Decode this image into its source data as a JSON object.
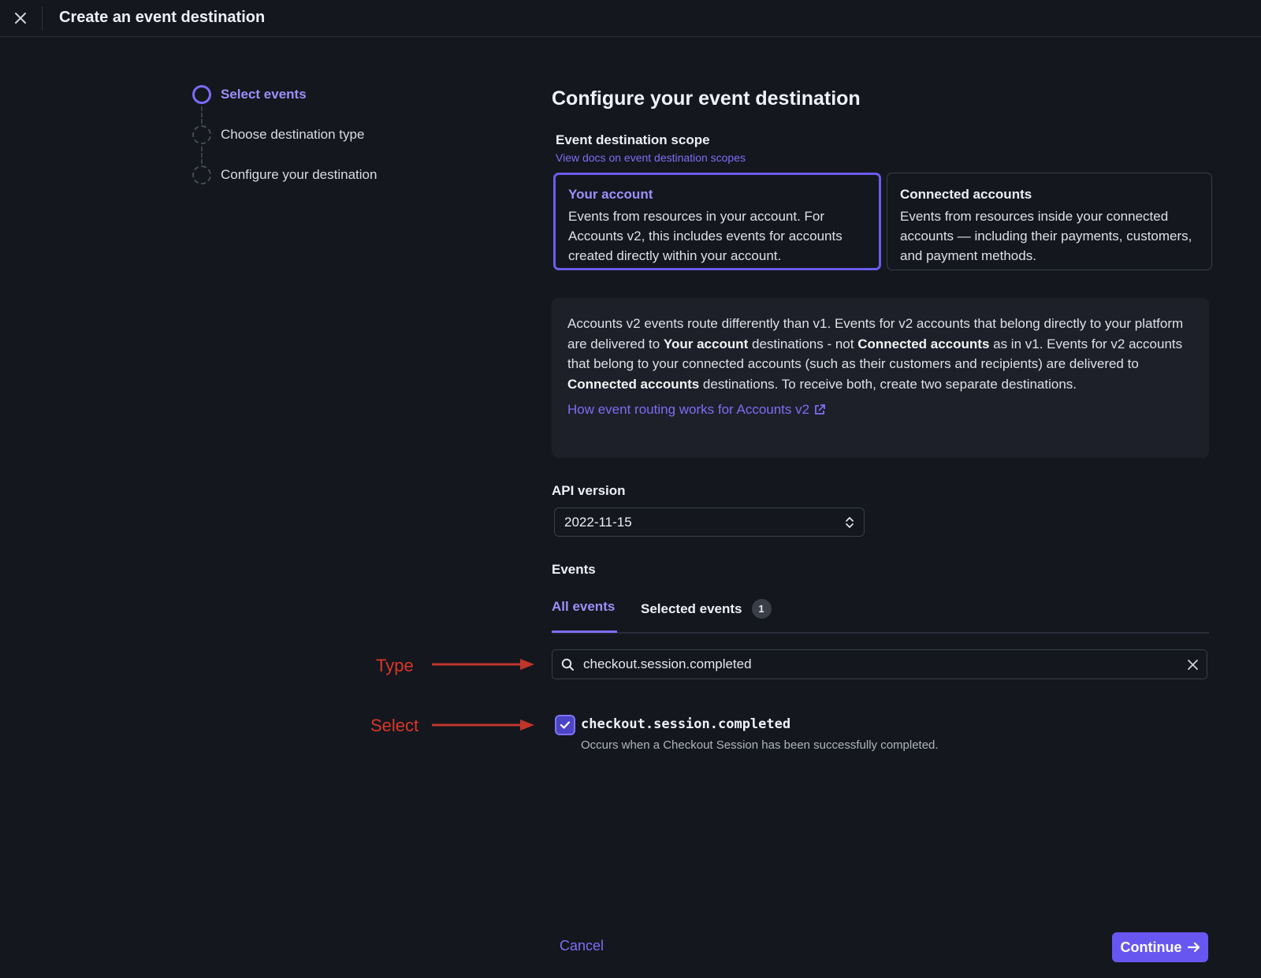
{
  "header": {
    "title": "Create an event destination"
  },
  "stepper": {
    "steps": [
      {
        "label": "Select events",
        "state": "active"
      },
      {
        "label": "Choose destination type",
        "state": "pending"
      },
      {
        "label": "Configure your destination",
        "state": "pending"
      }
    ]
  },
  "main": {
    "title": "Configure your event destination",
    "scope": {
      "title": "Event destination scope",
      "docs_link": "View docs on event destination scopes",
      "options": [
        {
          "title": "Your account",
          "description": "Events from resources in your account. For Accounts v2, this includes events for accounts created directly within your account.",
          "selected": true
        },
        {
          "title": "Connected accounts",
          "description": "Events from resources inside your connected accounts — including their payments, customers, and payment methods.",
          "selected": false
        }
      ]
    },
    "info": {
      "p1": "Accounts v2 events route differently than v1. Events for v2 accounts that belong directly to your platform are delivered to ",
      "b1": "Your account",
      "p2": " destinations - not ",
      "b2": "Connected accounts",
      "p3": " as in v1. Events for v2 accounts that belong to your connected accounts (such as their customers and recipients) are delivered to ",
      "b3": "Connected accounts",
      "p4": " destinations. To receive both, create two separate destinations.",
      "link": "How event routing works for Accounts v2"
    },
    "api_version": {
      "label": "API version",
      "value": "2022-11-15"
    },
    "events": {
      "label": "Events",
      "tabs": [
        {
          "label": "All events",
          "active": true
        },
        {
          "label": "Selected events",
          "count": "1",
          "active": false
        }
      ],
      "search": {
        "value": "checkout.session.completed"
      },
      "results": [
        {
          "name": "checkout.session.completed",
          "description": "Occurs when a Checkout Session has been successfully completed.",
          "checked": true
        }
      ]
    }
  },
  "annotations": {
    "type_label": "Type",
    "select_label": "Select"
  },
  "footer": {
    "cancel_label": "Cancel",
    "continue_label": "Continue"
  },
  "colors": {
    "accent": "#6757f0",
    "annotation": "#d9362a",
    "background": "#14171e"
  }
}
